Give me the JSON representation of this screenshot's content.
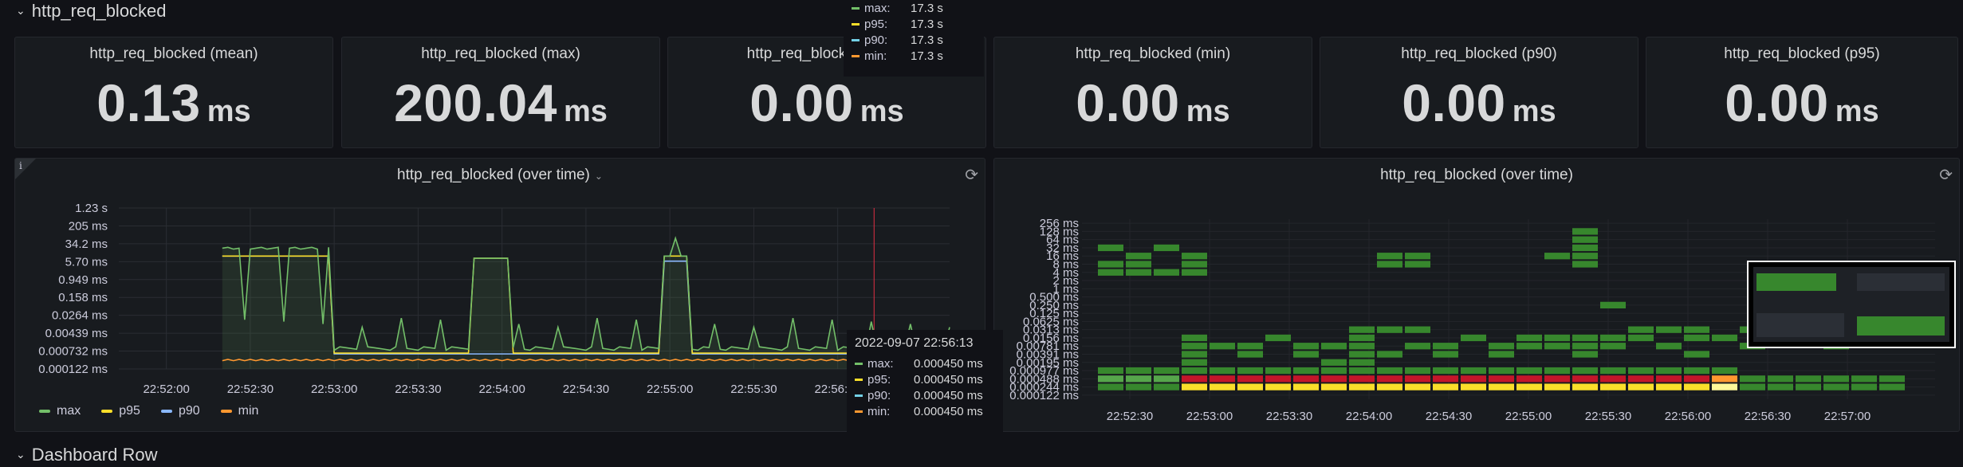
{
  "rows": {
    "top_title": "http_req_blocked",
    "bottom_title": "Dashboard Row"
  },
  "stats": [
    {
      "title": "http_req_blocked (mean)",
      "value": "0.13",
      "unit": "ms"
    },
    {
      "title": "http_req_blocked (max)",
      "value": "200.04",
      "unit": "ms"
    },
    {
      "title": "http_req_blocked (med)",
      "value": "0.00",
      "unit": "ms"
    },
    {
      "title": "http_req_blocked (min)",
      "value": "0.00",
      "unit": "ms"
    },
    {
      "title": "http_req_blocked (p90)",
      "value": "0.00",
      "unit": "ms"
    },
    {
      "title": "http_req_blocked (p95)",
      "value": "0.00",
      "unit": "ms"
    }
  ],
  "timeseries": {
    "title": "http_req_blocked (over time)",
    "info_glyph": "i",
    "refresh_glyph": "⟳",
    "chevron_glyph": "⌄",
    "legend": [
      {
        "name": "max",
        "color": "#73bf69"
      },
      {
        "name": "p95",
        "color": "#fade2a"
      },
      {
        "name": "p90",
        "color": "#8ab8ff"
      },
      {
        "name": "min",
        "color": "#ff9830"
      }
    ]
  },
  "tooltip_top": {
    "rows": [
      {
        "label": "max:",
        "value": "17.3 s",
        "color": "#73bf69"
      },
      {
        "label": "p95:",
        "value": "17.3 s",
        "color": "#fade2a"
      },
      {
        "label": "p90:",
        "value": "17.3 s",
        "color": "#73d0e6"
      },
      {
        "label": "min:",
        "value": "17.3 s",
        "color": "#ff9830"
      }
    ]
  },
  "tooltip_bottom": {
    "time": "2022-09-07 22:56:13",
    "rows": [
      {
        "label": "max:",
        "value": "0.000450 ms",
        "color": "#73bf69"
      },
      {
        "label": "p95:",
        "value": "0.000450 ms",
        "color": "#fade2a"
      },
      {
        "label": "p90:",
        "value": "0.000450 ms",
        "color": "#73d0e6"
      },
      {
        "label": "min:",
        "value": "0.000450 ms",
        "color": "#ff9830"
      }
    ]
  },
  "heatmap": {
    "title": "http_req_blocked (over time)",
    "refresh_glyph": "⟳"
  },
  "chart_data": [
    {
      "type": "line",
      "title": "http_req_blocked (over time)",
      "y_scale": "log",
      "y_ticks": [
        "1.23 s",
        "205 ms",
        "34.2 ms",
        "5.70 ms",
        "0.949 ms",
        "0.158 ms",
        "0.0264 ms",
        "0.00439 ms",
        "0.000732 ms",
        "0.000122 ms"
      ],
      "x_ticks": [
        "22:52:00",
        "22:52:30",
        "22:53:00",
        "22:53:30",
        "22:54:00",
        "22:54:30",
        "22:55:00",
        "22:55:30",
        "22:56:00"
      ],
      "series": [
        {
          "name": "max",
          "color": "#73bf69"
        },
        {
          "name": "p95",
          "color": "#fade2a"
        },
        {
          "name": "p90",
          "color": "#8ab8ff"
        },
        {
          "name": "min",
          "color": "#ff9830"
        }
      ],
      "spikes_ms": [
        {
          "t": "22:52:20",
          "max": 30,
          "p95": 12,
          "p90": 12,
          "min": 0.0003
        },
        {
          "t": "22:52:40",
          "max": 40,
          "p95": 15,
          "p90": 15,
          "min": 0.0003
        },
        {
          "t": "22:52:50",
          "max": 10,
          "p95": 10,
          "p90": 10,
          "min": 0.0003
        },
        {
          "t": "22:53:00",
          "max": 0.0012,
          "p95": 0.0006,
          "p90": 0.0005,
          "min": 0.0002
        },
        {
          "t": "22:53:50",
          "max": 8,
          "p95": 8,
          "p90": 0.0007,
          "min": 0.0002
        },
        {
          "t": "22:54:00",
          "max": 8,
          "p95": 8,
          "p90": 0.0007,
          "min": 0.0002
        },
        {
          "t": "22:55:00",
          "max": 60,
          "p95": 10,
          "p90": 6,
          "min": 0.0002
        },
        {
          "t": "22:56:00",
          "max": 0.0006,
          "p95": 0.0005,
          "p90": 0.0005,
          "min": 0.0004
        }
      ],
      "legend_position": "bottom-left",
      "grid": true
    },
    {
      "type": "heatmap",
      "title": "http_req_blocked (over time)",
      "y_ticks": [
        "256 ms",
        "128 ms",
        "64 ms",
        "32 ms",
        "16 ms",
        "8 ms",
        "4 ms",
        "2 ms",
        "1 ms",
        "0.500 ms",
        "0.250 ms",
        "0.125 ms",
        "0.0625 ms",
        "0.0313 ms",
        "0.0156 ms",
        "0.00781 ms",
        "0.00391 ms",
        "0.00195 ms",
        "0.000977 ms",
        "0.000488 ms",
        "0.000244 ms",
        "0.000122 ms"
      ],
      "x_ticks": [
        "22:52:30",
        "22:53:00",
        "22:53:30",
        "22:54:00",
        "22:54:30",
        "22:55:00",
        "22:55:30",
        "22:56:00",
        "22:56:30",
        "22:57:00"
      ],
      "cells": [
        [
          0,
          18,
          1
        ],
        [
          0,
          19,
          2
        ],
        [
          0,
          20,
          1
        ],
        [
          0,
          6,
          1
        ],
        [
          0,
          5,
          1
        ],
        [
          0,
          3,
          1
        ],
        [
          1,
          18,
          1
        ],
        [
          1,
          19,
          2
        ],
        [
          1,
          20,
          1
        ],
        [
          1,
          6,
          1
        ],
        [
          1,
          5,
          1
        ],
        [
          1,
          4,
          1
        ],
        [
          2,
          18,
          1
        ],
        [
          2,
          19,
          2
        ],
        [
          2,
          20,
          1
        ],
        [
          2,
          6,
          1
        ],
        [
          2,
          3,
          1
        ],
        [
          3,
          18,
          1
        ],
        [
          3,
          19,
          3
        ],
        [
          3,
          20,
          4
        ],
        [
          3,
          6,
          1
        ],
        [
          3,
          5,
          1
        ],
        [
          3,
          4,
          1
        ],
        [
          3,
          14,
          1
        ],
        [
          3,
          15,
          1
        ],
        [
          3,
          16,
          1
        ],
        [
          3,
          17,
          1
        ],
        [
          4,
          18,
          1
        ],
        [
          4,
          19,
          3
        ],
        [
          4,
          20,
          4
        ],
        [
          4,
          15,
          1
        ],
        [
          5,
          18,
          1
        ],
        [
          5,
          19,
          3
        ],
        [
          5,
          20,
          4
        ],
        [
          5,
          15,
          1
        ],
        [
          5,
          16,
          1
        ],
        [
          6,
          18,
          1
        ],
        [
          6,
          19,
          3
        ],
        [
          6,
          20,
          4
        ],
        [
          6,
          14,
          1
        ],
        [
          7,
          18,
          1
        ],
        [
          7,
          19,
          3
        ],
        [
          7,
          20,
          4
        ],
        [
          7,
          15,
          1
        ],
        [
          7,
          16,
          1
        ],
        [
          8,
          18,
          1
        ],
        [
          8,
          19,
          3
        ],
        [
          8,
          20,
          4
        ],
        [
          8,
          15,
          1
        ],
        [
          8,
          17,
          1
        ],
        [
          9,
          18,
          1
        ],
        [
          9,
          19,
          3
        ],
        [
          9,
          20,
          4
        ],
        [
          9,
          13,
          1
        ],
        [
          9,
          14,
          1
        ],
        [
          9,
          15,
          1
        ],
        [
          9,
          16,
          1
        ],
        [
          9,
          17,
          1
        ],
        [
          10,
          18,
          1
        ],
        [
          10,
          19,
          3
        ],
        [
          10,
          20,
          4
        ],
        [
          10,
          13,
          1
        ],
        [
          10,
          5,
          1
        ],
        [
          10,
          4,
          1
        ],
        [
          10,
          16,
          1
        ],
        [
          11,
          18,
          1
        ],
        [
          11,
          19,
          3
        ],
        [
          11,
          20,
          4
        ],
        [
          11,
          13,
          1
        ],
        [
          11,
          5,
          1
        ],
        [
          11,
          4,
          1
        ],
        [
          11,
          15,
          1
        ],
        [
          12,
          18,
          1
        ],
        [
          12,
          19,
          3
        ],
        [
          12,
          20,
          4
        ],
        [
          12,
          15,
          1
        ],
        [
          12,
          16,
          1
        ],
        [
          13,
          18,
          1
        ],
        [
          13,
          19,
          3
        ],
        [
          13,
          20,
          4
        ],
        [
          13,
          14,
          1
        ],
        [
          14,
          18,
          1
        ],
        [
          14,
          19,
          3
        ],
        [
          14,
          20,
          4
        ],
        [
          14,
          15,
          1
        ],
        [
          14,
          16,
          1
        ],
        [
          15,
          18,
          1
        ],
        [
          15,
          19,
          3
        ],
        [
          15,
          20,
          4
        ],
        [
          15,
          14,
          1
        ],
        [
          15,
          15,
          1
        ],
        [
          16,
          18,
          1
        ],
        [
          16,
          19,
          3
        ],
        [
          16,
          20,
          4
        ],
        [
          16,
          14,
          1
        ],
        [
          16,
          15,
          1
        ],
        [
          16,
          4,
          1
        ],
        [
          17,
          18,
          1
        ],
        [
          17,
          19,
          3
        ],
        [
          17,
          20,
          4
        ],
        [
          17,
          14,
          1
        ],
        [
          17,
          15,
          1
        ],
        [
          17,
          16,
          1
        ],
        [
          17,
          1,
          1
        ],
        [
          17,
          2,
          1
        ],
        [
          17,
          5,
          1
        ],
        [
          17,
          4,
          1
        ],
        [
          17,
          3,
          1
        ],
        [
          18,
          18,
          1
        ],
        [
          18,
          19,
          3
        ],
        [
          18,
          20,
          4
        ],
        [
          18,
          10,
          1
        ],
        [
          18,
          14,
          1
        ],
        [
          18,
          15,
          1
        ],
        [
          19,
          18,
          1
        ],
        [
          19,
          19,
          3
        ],
        [
          19,
          20,
          4
        ],
        [
          19,
          13,
          1
        ],
        [
          19,
          14,
          1
        ],
        [
          20,
          18,
          1
        ],
        [
          20,
          19,
          3
        ],
        [
          20,
          20,
          4
        ],
        [
          20,
          13,
          1
        ],
        [
          20,
          15,
          1
        ],
        [
          21,
          18,
          1
        ],
        [
          21,
          19,
          3
        ],
        [
          21,
          20,
          4
        ],
        [
          21,
          13,
          1
        ],
        [
          21,
          14,
          1
        ],
        [
          21,
          16,
          1
        ],
        [
          22,
          18,
          1
        ],
        [
          22,
          19,
          5
        ],
        [
          22,
          20,
          6
        ],
        [
          22,
          14,
          1
        ],
        [
          23,
          19,
          1
        ],
        [
          23,
          20,
          1
        ],
        [
          23,
          15,
          1
        ],
        [
          23,
          13,
          1
        ],
        [
          24,
          19,
          1
        ],
        [
          24,
          20,
          1
        ],
        [
          24,
          14,
          1
        ],
        [
          25,
          19,
          1
        ],
        [
          25,
          20,
          1
        ],
        [
          25,
          13,
          1
        ],
        [
          26,
          19,
          1
        ],
        [
          26,
          20,
          1
        ],
        [
          26,
          15,
          1
        ],
        [
          27,
          19,
          1
        ],
        [
          27,
          20,
          1
        ],
        [
          27,
          13,
          1
        ],
        [
          28,
          19,
          1
        ],
        [
          28,
          20,
          1
        ],
        [
          28,
          14,
          1
        ]
      ]
    }
  ]
}
